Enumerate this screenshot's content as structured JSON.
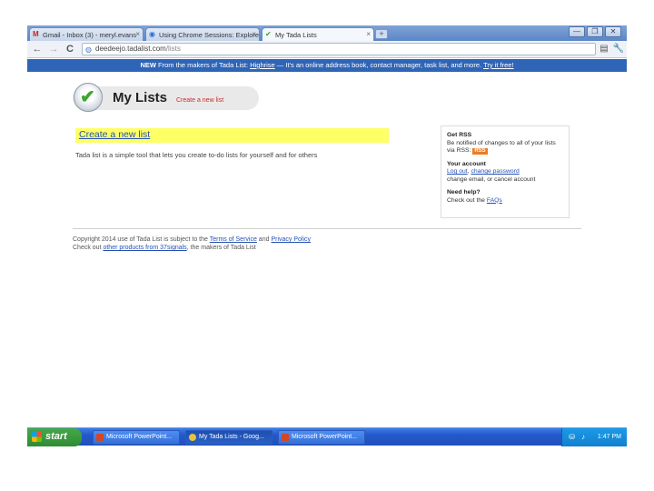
{
  "browser": {
    "tabs": [
      {
        "label": "Gmail - Inbox (3) - meryl.evans",
        "icon": "gmail-icon",
        "active": false
      },
      {
        "label": "Using Chrome Sessions: Explore",
        "icon": "chrome-icon",
        "active": false
      },
      {
        "label": "My Tada Lists",
        "icon": "tadalist-icon",
        "active": true
      }
    ],
    "close_glyph": "×",
    "new_tab_glyph": "+",
    "window_buttons": [
      "—",
      "❐",
      "✕"
    ],
    "nav": {
      "back": "←",
      "forward": "→",
      "reload": "C"
    },
    "url": {
      "host": "deedeejo.tadalist.com",
      "path": "/lists"
    },
    "notice": {
      "prefix": "NEW",
      "text_before": " From the makers of Tada List: ",
      "link": "Highrise",
      "text_after": " — It's an online address book, contact manager, task list, and more. ",
      "cta": "Try it free!"
    }
  },
  "page": {
    "logo_title": "My Lists",
    "logo_link": "Create a new list",
    "create_link": "Create a new list",
    "description": "Tada list is a simple tool that lets you create to-do lists for yourself and for others",
    "sidebar": {
      "rss_heading": "Get RSS",
      "rss_text": "Be notified of changes to all of your lists via RSS: ",
      "rss_badge": "RSS",
      "account_heading": "Your account",
      "logout": "Log out",
      "change_password": "change password",
      "account_text": "change email, or cancel account",
      "help_heading": "Need help?",
      "help_text": "Check out the ",
      "faqs": "FAQs"
    },
    "footer": {
      "line1_before": "Copyright 2014 use of Tada List is subject to the ",
      "terms": "Terms of Service",
      "and": " and ",
      "privacy": "Privacy Policy",
      "line2_before": "Check out ",
      "other_products": "other products from 37signals",
      "line2_after": ", the makers of Tada List"
    }
  },
  "taskbar": {
    "start_label": "start",
    "tasks": [
      {
        "label": "Microsoft PowerPoint...",
        "icon": "powerpoint-icon",
        "active": false
      },
      {
        "label": "My Tada Lists - Goog...",
        "icon": "chrome-icon",
        "active": true
      },
      {
        "label": "Microsoft PowerPoint...",
        "icon": "powerpoint-icon",
        "active": false
      }
    ],
    "clock": "1:47 PM"
  },
  "colors": {
    "notice_bar": "#2f65b7",
    "highlight": "#ffff66",
    "link": "#2450b5",
    "accent_red": "#cc2a2a",
    "taskbar": "#2458c9",
    "start": "#2f8b33"
  }
}
